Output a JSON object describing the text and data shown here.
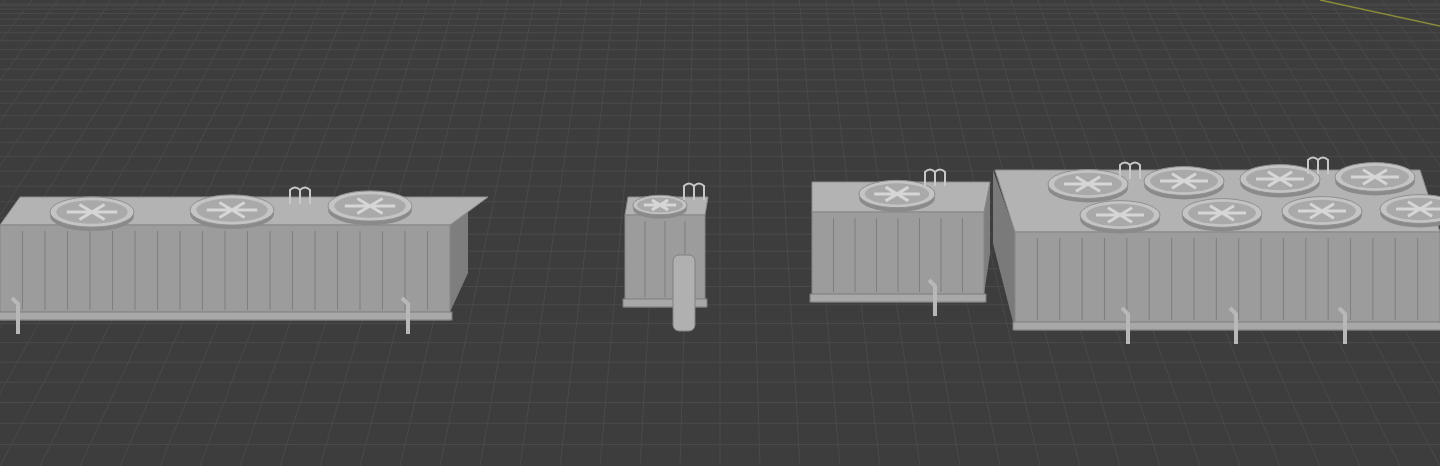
{
  "viewport": {
    "units": [
      {
        "kind": "three-fan-unit"
      },
      {
        "kind": "small-unit"
      },
      {
        "kind": "single-fan-unit"
      },
      {
        "kind": "eight-fan-unit"
      }
    ]
  }
}
